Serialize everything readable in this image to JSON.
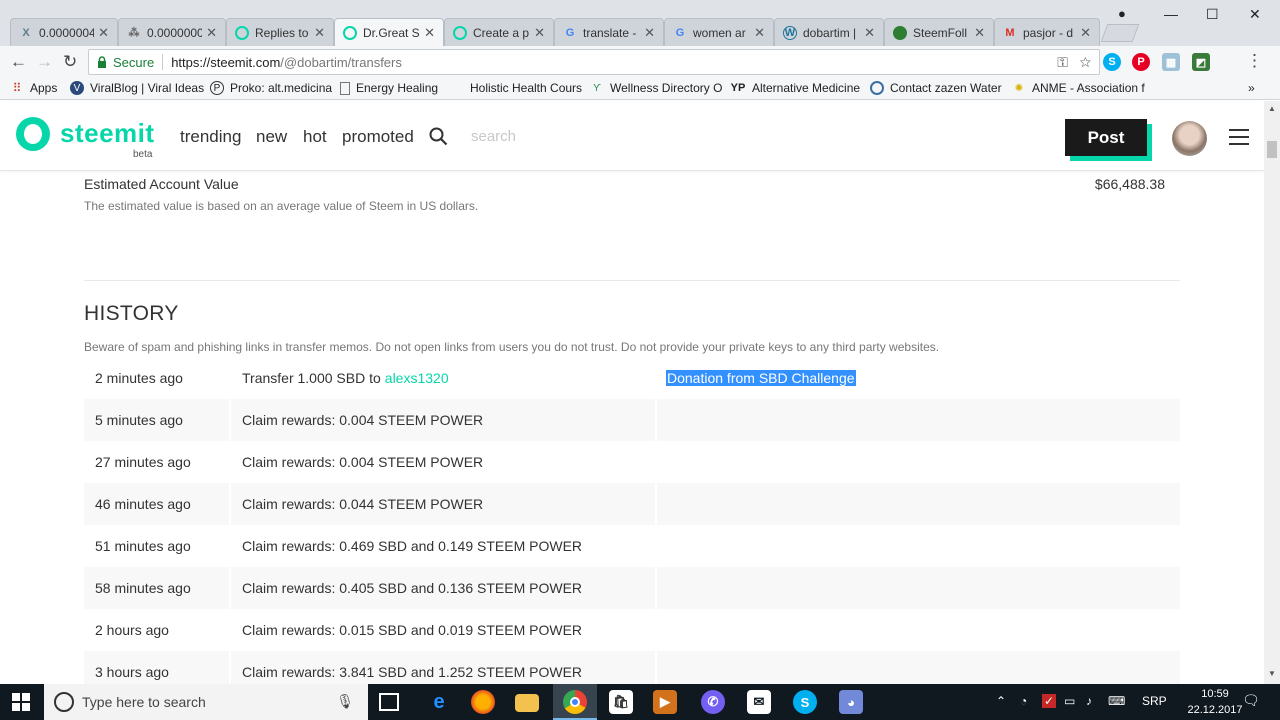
{
  "browser": {
    "tabs": [
      {
        "title": "0.0000004",
        "icon": "x-icon",
        "color": "#607d8b"
      },
      {
        "title": "0.0000000",
        "icon": "share-icon",
        "color": "#666"
      },
      {
        "title": "Replies to",
        "icon": "steemit-icon",
        "color": "#06d6a9"
      },
      {
        "title": "Dr.Great S",
        "icon": "steemit-icon",
        "color": "#06d6a9",
        "active": true
      },
      {
        "title": "Create a p",
        "icon": "steemit-icon",
        "color": "#06d6a9"
      },
      {
        "title": "translate -",
        "icon": "google-icon",
        "color": "#4285f4"
      },
      {
        "title": "women ar",
        "icon": "google-icon",
        "color": "#4285f4"
      },
      {
        "title": "dobartim |",
        "icon": "wordpress-icon",
        "color": "#21759b"
      },
      {
        "title": "SteemFoll",
        "icon": "steemfollower-icon",
        "color": "#2e7d32"
      },
      {
        "title": "pasjor - d",
        "icon": "gmail-icon",
        "color": "#d93025"
      }
    ],
    "secure_label": "Secure",
    "url_host": "https://steemit.com",
    "url_path": "/@dobartim/transfers",
    "bookmarks": [
      {
        "label": "Apps",
        "icon": "apps-grid-icon"
      },
      {
        "label": "ViralBlog | Viral Ideas",
        "icon": "viralblog-icon"
      },
      {
        "label": "Proko: alt.medicina",
        "icon": "proko-icon"
      },
      {
        "label": "Energy Healing",
        "icon": "page-icon"
      },
      {
        "label": "Holistic Health Cours",
        "icon": "blank-icon"
      },
      {
        "label": "Wellness Directory O",
        "icon": "sprout-icon"
      },
      {
        "label": "Alternative Medicine",
        "icon": "yp-icon"
      },
      {
        "label": "Contact zazen Water",
        "icon": "zazen-icon"
      },
      {
        "label": "ANME - Association f",
        "icon": "sun-icon"
      }
    ]
  },
  "site": {
    "logo": "steemit",
    "beta": "beta",
    "nav": [
      "trending",
      "new",
      "hot",
      "promoted"
    ],
    "search_placeholder": "search",
    "post_label": "Post",
    "accent": "#06d6a9"
  },
  "account": {
    "label": "Estimated Account Value",
    "value": "$66,488.38",
    "description": "The estimated value is based on an average value of Steem in US dollars."
  },
  "history": {
    "title": "HISTORY",
    "warning": "Beware of spam and phishing links in transfer memos. Do not open links from users you do not trust. Do not provide your private keys to any third party websites.",
    "rows": [
      {
        "time": "2 minutes ago",
        "text": "Transfer 1.000 SBD to",
        "link": "alexs1320",
        "memo": "Donation from SBD Challenge"
      },
      {
        "time": "5 minutes ago",
        "text": "Claim rewards: 0.004 STEEM POWER",
        "link": "",
        "memo": ""
      },
      {
        "time": "27 minutes ago",
        "text": "Claim rewards: 0.004 STEEM POWER",
        "link": "",
        "memo": ""
      },
      {
        "time": "46 minutes ago",
        "text": "Claim rewards: 0.044 STEEM POWER",
        "link": "",
        "memo": ""
      },
      {
        "time": "51 minutes ago",
        "text": "Claim rewards: 0.469 SBD and 0.149 STEEM POWER",
        "link": "",
        "memo": ""
      },
      {
        "time": "58 minutes ago",
        "text": "Claim rewards: 0.405 SBD and 0.136 STEEM POWER",
        "link": "",
        "memo": ""
      },
      {
        "time": "2 hours ago",
        "text": "Claim rewards: 0.015 SBD and 0.019 STEEM POWER",
        "link": "",
        "memo": ""
      },
      {
        "time": "3 hours ago",
        "text": "Claim rewards: 3.841 SBD and 1.252 STEEM POWER",
        "link": "",
        "memo": ""
      }
    ]
  },
  "taskbar": {
    "search_placeholder": "Type here to search",
    "language": "SRP",
    "time": "10:59",
    "date": "22.12.2017"
  }
}
